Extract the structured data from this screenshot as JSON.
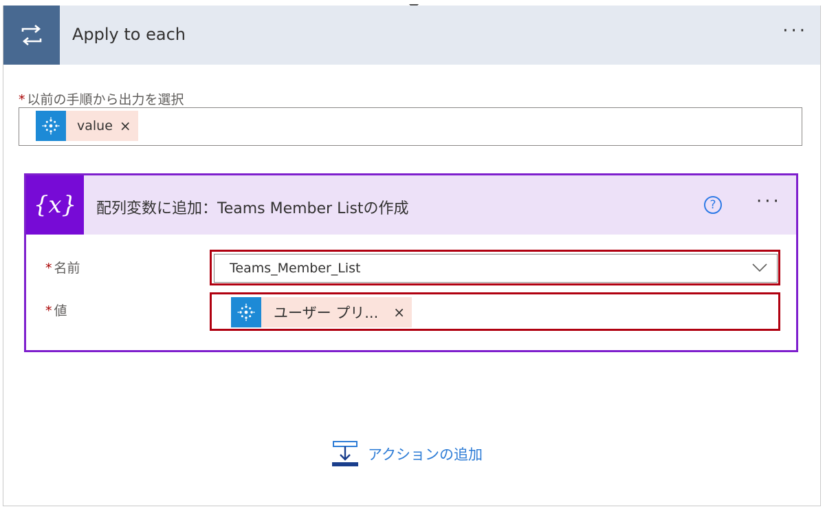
{
  "loop": {
    "title": "Apply to each",
    "more": "···",
    "icon": "loop-icon",
    "select_output": {
      "label": "以前の手順から出力を選択",
      "required": "*",
      "token": {
        "text": "value",
        "remove": "×",
        "icon": "microsoft-graph-icon"
      }
    }
  },
  "action": {
    "title": "配列変数に追加：Teams Member Listの作成",
    "icon_text": "{x}",
    "help": "?",
    "more": "···",
    "name_field": {
      "label": "名前",
      "required": "*",
      "value": "Teams_Member_List"
    },
    "value_field": {
      "label": "値",
      "required": "*",
      "token": {
        "text": "ユーザー プリ...",
        "remove": "×",
        "icon": "microsoft-graph-icon"
      }
    }
  },
  "add_action": {
    "label": "アクションの追加",
    "icon": "add-action-icon"
  },
  "colors": {
    "loop_header_bg": "#e4e9f1",
    "loop_icon_bg": "#486991",
    "action_border": "#7e1fcd",
    "action_header_bg": "#ede1f8",
    "action_icon_bg": "#770bd6",
    "token_bg": "#fbe3dc",
    "token_icon_bg": "#1d8ad6",
    "highlight": "#b00010",
    "link": "#2d7cd6"
  }
}
